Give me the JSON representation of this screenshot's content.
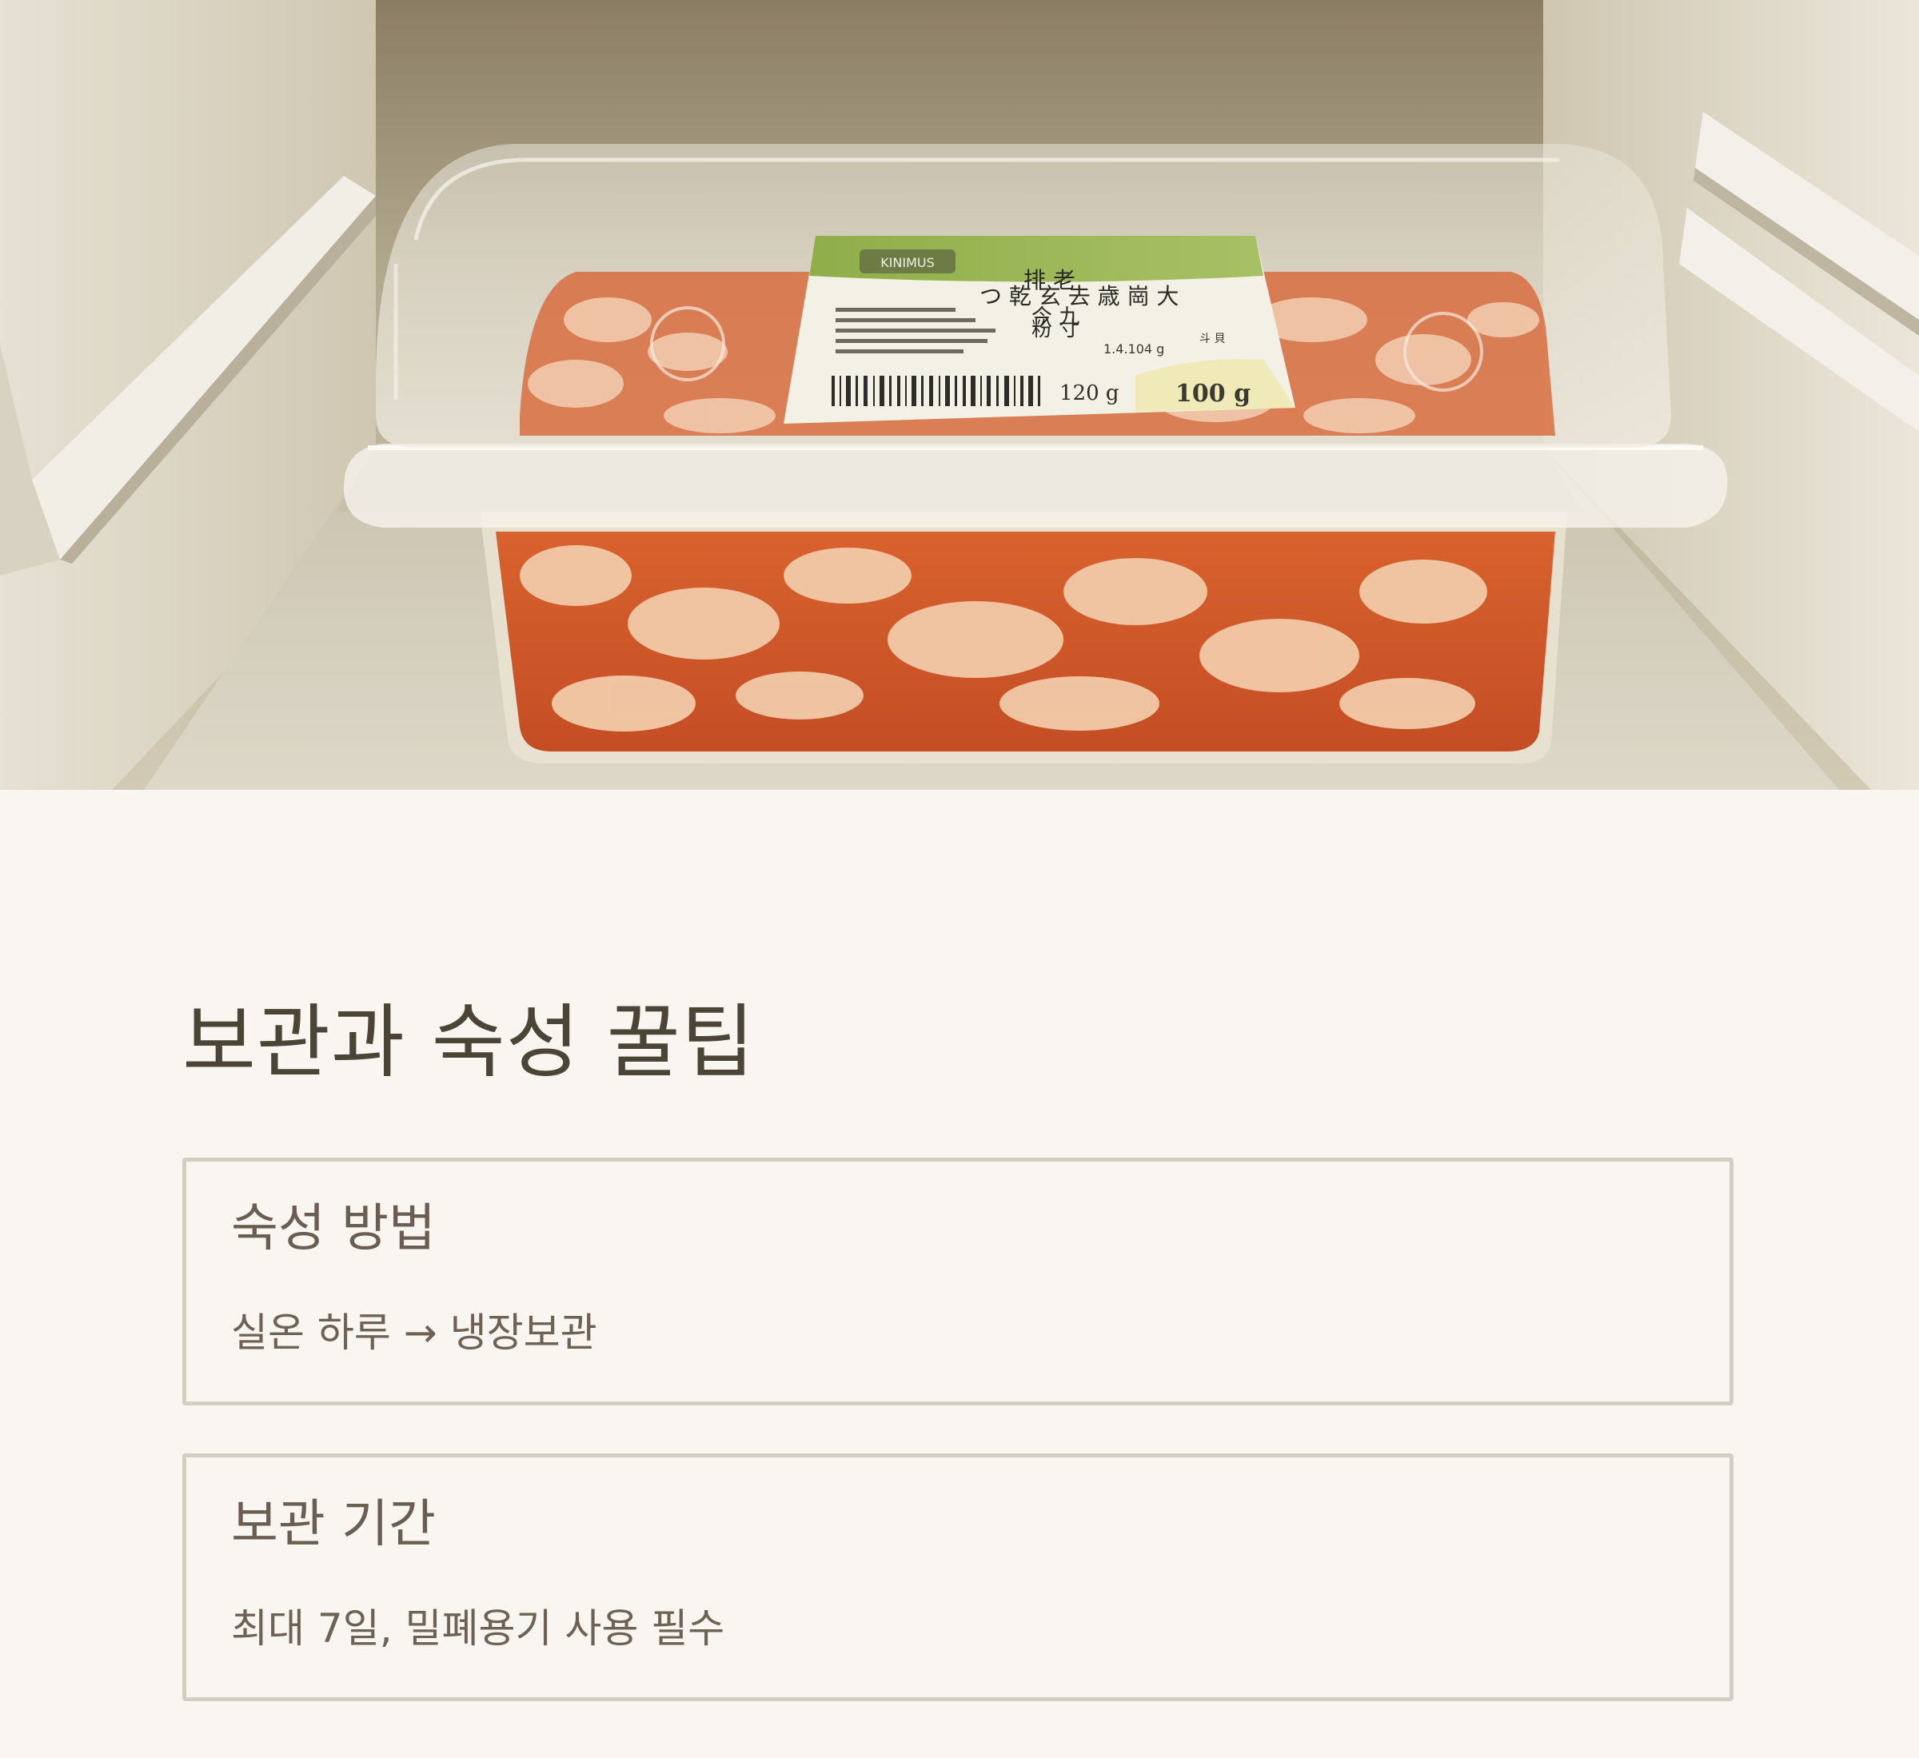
{
  "hero": {
    "alt": "냉장고 속 밀폐용기에 담긴 양념 반찬",
    "label": {
      "brand": "KINIMUS",
      "hanzi_line1": "排 老",
      "hanzi_line2": "つ 乾 玄 去 歳 崗 大",
      "hanzi_line3": "今 九",
      "hanzi_line4": "粉 寸",
      "small_weight": "1.4.104 g",
      "small_side": "斗 貝",
      "weight_small": "120 g",
      "weight_big": "100 g"
    }
  },
  "section": {
    "title": "보관과 숙성 꿀팁"
  },
  "cards": [
    {
      "title": "숙성 방법",
      "text": "실온 하루 → 냉장보관"
    },
    {
      "title": "보관 기간",
      "text": "최대 7일, 밀폐용기 사용 필수"
    }
  ],
  "colors": {
    "background": "#f9f6f1",
    "title": "#4a4536",
    "card_border": "#d2cec3",
    "card_text": "#6e6255",
    "label_green": "#9bb556"
  }
}
